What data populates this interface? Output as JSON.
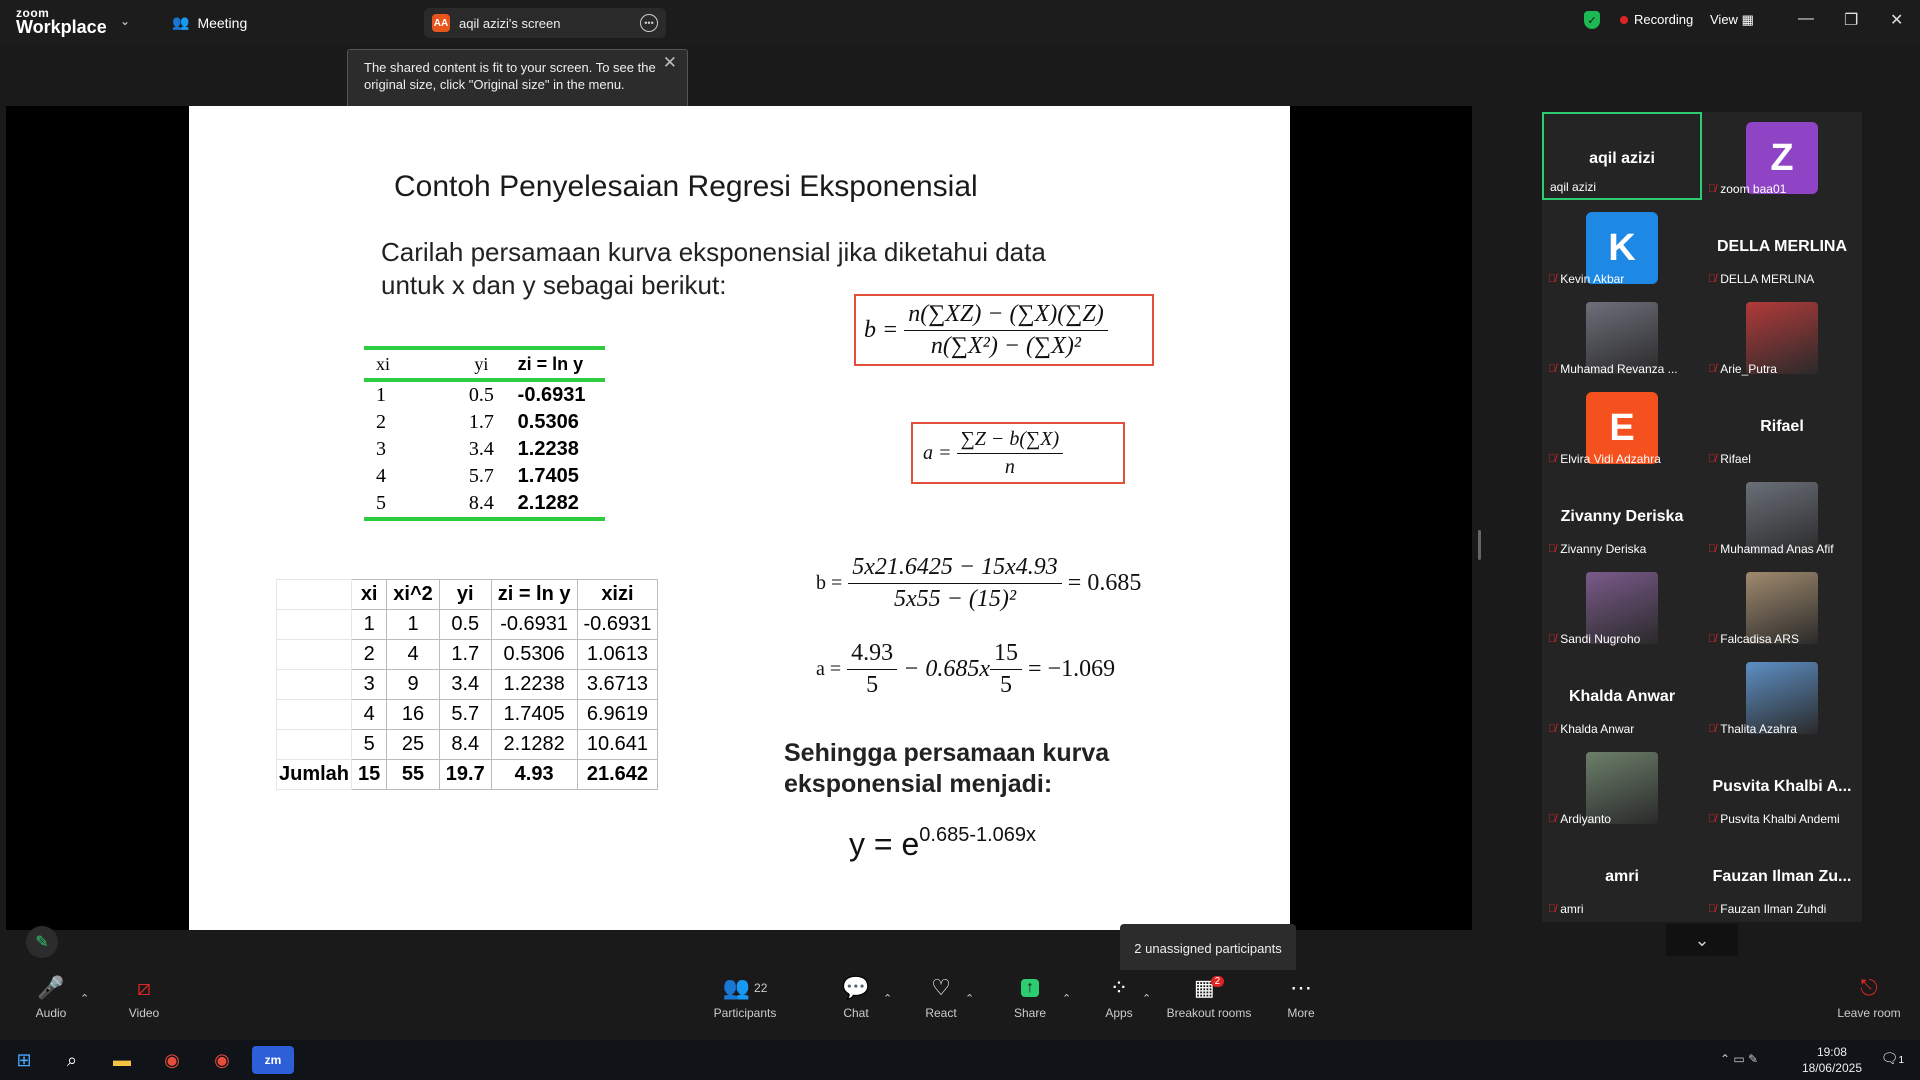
{
  "app": {
    "logo_top": "zoom",
    "logo_bottom": "Workplace",
    "meeting_label": "Meeting",
    "share_tab_initials": "AA",
    "share_tab_title": "aqil azizi's screen",
    "recording": "Recording",
    "view": "View"
  },
  "tooltip": {
    "text": "The shared content is fit to your screen. To see the original size, click \"Original size\" in the menu."
  },
  "slide": {
    "title": "Contoh Penyelesaian Regresi Eksponensial",
    "question": "Carilah persamaan kurva eksponensial jika diketahui data untuk x dan y sebagai berikut:",
    "formula_b": {
      "lhs": "b =",
      "num": "n(∑XZ) − (∑X)(∑Z)",
      "den": "n(∑X²) − (∑X)²"
    },
    "formula_a": {
      "lhs": "a =",
      "num": "∑Z − b(∑X)",
      "den": "n"
    },
    "table1": {
      "headers": [
        "xi",
        "yi",
        "zi = ln y"
      ],
      "rows": [
        [
          "1",
          "0.5",
          "-0.6931"
        ],
        [
          "2",
          "1.7",
          "0.5306"
        ],
        [
          "3",
          "3.4",
          "1.2238"
        ],
        [
          "4",
          "5.7",
          "1.7405"
        ],
        [
          "5",
          "8.4",
          "2.1282"
        ]
      ]
    },
    "table2": {
      "headers": [
        "xi",
        "xi^2",
        "yi",
        "zi = ln y",
        "xizi"
      ],
      "rows": [
        [
          "1",
          "1",
          "0.5",
          "-0.6931",
          "-0.6931"
        ],
        [
          "2",
          "4",
          "1.7",
          "0.5306",
          "1.0613"
        ],
        [
          "3",
          "9",
          "3.4",
          "1.2238",
          "3.6713"
        ],
        [
          "4",
          "16",
          "5.7",
          "1.7405",
          "6.9619"
        ],
        [
          "5",
          "25",
          "8.4",
          "2.1282",
          "10.641"
        ]
      ],
      "sum_label": "Jumlah",
      "sums": [
        "15",
        "55",
        "19.7",
        "4.93",
        "21.642"
      ]
    },
    "calc_b": {
      "lhs": "b =",
      "num": "5x21.6425 − 15x4.93",
      "den": "5x55 − (15)²",
      "result": "= 0.685"
    },
    "calc_a": {
      "lhs": "a =",
      "n1": "4.93",
      "d1": "5",
      "mid": "− 0.685x",
      "n2": "15",
      "d2": "5",
      "result": "= −1.069"
    },
    "conclusion": "Sehingga persamaan kurva eksponensial menjadi:",
    "final_base": "y = e",
    "final_exp": "0.685-1.069x"
  },
  "participants": [
    {
      "name": "aqil azizi",
      "label": "aqil azizi",
      "kind": "name"
    },
    {
      "name": "Z",
      "label": "zoom baa01",
      "kind": "avatar",
      "color": "#8e44c4"
    },
    {
      "name": "K",
      "label": "Kevin Akbar",
      "kind": "avatar",
      "color": "#1e88e5"
    },
    {
      "name": "DELLA MERLINA",
      "label": "DELLA MERLINA",
      "kind": "name"
    },
    {
      "name": "",
      "label": "Muhamad Revanza ...",
      "kind": "photo",
      "color": "#6d6f7a"
    },
    {
      "name": "",
      "label": "Arie_Putra",
      "kind": "photo",
      "color": "#b23a3a"
    },
    {
      "name": "E",
      "label": "Elvira Vidi Adzahra",
      "kind": "avatar",
      "color": "#f4511e"
    },
    {
      "name": "Rifael",
      "label": "Rifael",
      "kind": "name"
    },
    {
      "name": "Zivanny Deriska",
      "label": "Zivanny Deriska",
      "kind": "name"
    },
    {
      "name": "",
      "label": "Muhammad Anas Afif",
      "kind": "photo",
      "color": "#6a6f78"
    },
    {
      "name": "",
      "label": "Sandi Nugroho",
      "kind": "photo",
      "color": "#7a5a8a"
    },
    {
      "name": "",
      "label": "Falcadisa ARS",
      "kind": "photo",
      "color": "#a08a6e"
    },
    {
      "name": "Khalda Anwar",
      "label": "Khalda Anwar",
      "kind": "name"
    },
    {
      "name": "",
      "label": "Thalita Azahra",
      "kind": "photo",
      "color": "#5d8fc4"
    },
    {
      "name": "",
      "label": "Ardiyanto",
      "kind": "photo",
      "color": "#6c7f6a"
    },
    {
      "name": "Pusvita Khalbi A...",
      "label": "Pusvita Khalbi Andemi",
      "kind": "name"
    },
    {
      "name": "amri",
      "label": "amri",
      "kind": "name"
    },
    {
      "name": "Fauzan Ilman Zu...",
      "label": "Fauzan Ilman Zuhdi",
      "kind": "name"
    }
  ],
  "unassigned": "2 unassigned participants",
  "toolbar": {
    "audio": "Audio",
    "video": "Video",
    "participants": "Participants",
    "participants_count": "22",
    "chat": "Chat",
    "react": "React",
    "share": "Share",
    "apps": "Apps",
    "breakout": "Breakout rooms",
    "breakout_badge": "2",
    "more": "More",
    "leave": "Leave room"
  },
  "taskbar": {
    "time": "19:08",
    "date": "18/06/2025",
    "notif": "1"
  },
  "colors": {
    "accent_green": "#2ecc71",
    "record_red": "#e02424",
    "box_red": "#e0503a"
  }
}
